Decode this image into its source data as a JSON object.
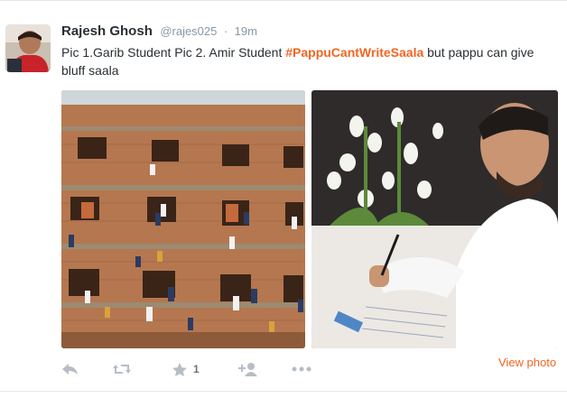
{
  "tweet": {
    "author_name": "Rajesh Ghosh",
    "author_handle": "@rajes025",
    "separator": "·",
    "time_ago": "19m",
    "text_before": "Pic 1.Garib Student Pic 2. Amir Student ",
    "hashtag": "#PappuCantWriteSaala",
    "text_after": " but pappu can give bluff saala"
  },
  "media": {
    "photos": [
      {
        "subject": "building-with-people-climbing"
      },
      {
        "subject": "man-writing-in-book-with-flowers"
      }
    ],
    "view_photo_label": "View photo"
  },
  "actions": {
    "reply_icon": "reply-icon",
    "retweet_icon": "retweet-icon",
    "favorite_icon": "star-icon",
    "favorite_count": "1",
    "follow_icon": "follow-icon",
    "more_icon": "more-icon"
  },
  "colors": {
    "accent": "#f26522",
    "text": "#292f33",
    "secondary": "#8899a6",
    "action_icon": "#b5bec6"
  }
}
